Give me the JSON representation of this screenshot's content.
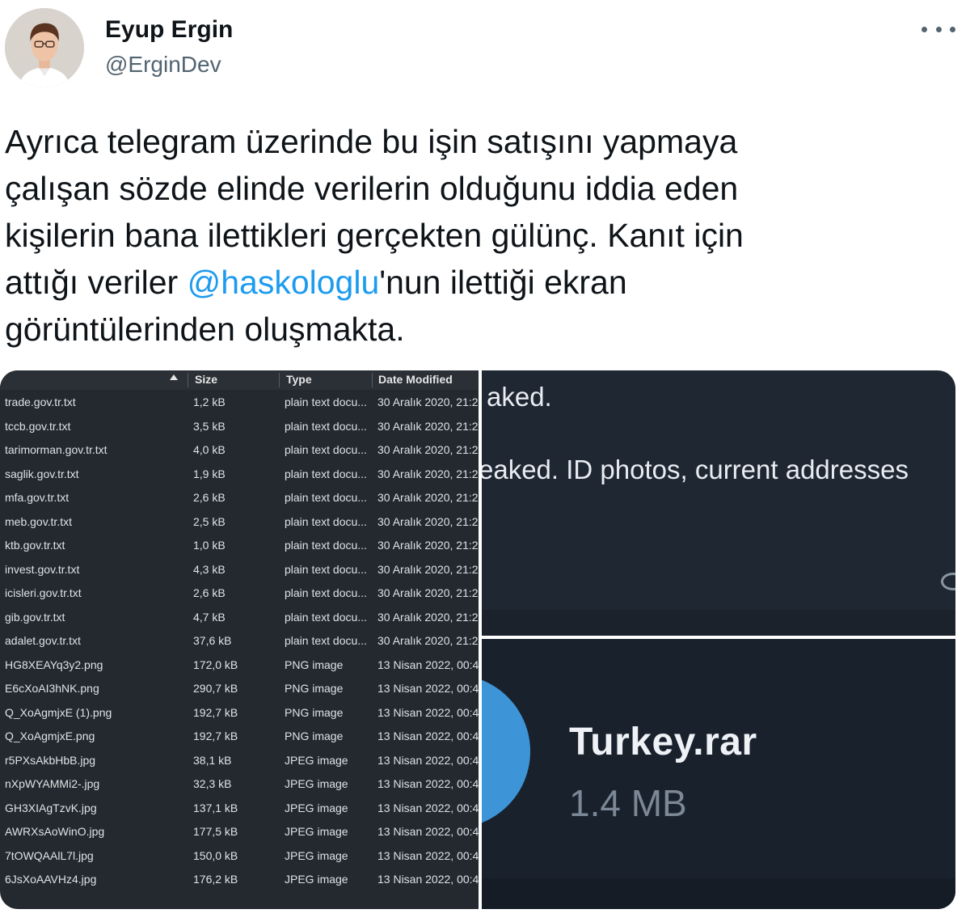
{
  "author": {
    "name": "Eyup Ergin",
    "handle": "@ErginDev"
  },
  "tweet": {
    "text_before": "Ayrıca telegram üzerinde bu işin satışını yapmaya\nçalışan sözde elinde verilerin olduğunu iddia eden\nkişilerin bana ilettikleri gerçekten gülünç. Kanıt için\nattığı veriler ",
    "mention": "@haskologlu",
    "text_after": "'nun ilettiği ekran\ngörüntülerinden oluşmakta."
  },
  "file_list": {
    "headers": {
      "size": "Size",
      "type": "Type",
      "date": "Date Modified"
    },
    "rows": [
      {
        "name": "trade.gov.tr.txt",
        "size": "1,2 kB",
        "type": "plain text docu...",
        "date": "30 Aralık 2020, 21:2"
      },
      {
        "name": "tccb.gov.tr.txt",
        "size": "3,5 kB",
        "type": "plain text docu...",
        "date": "30 Aralık 2020, 21:2"
      },
      {
        "name": "tarimorman.gov.tr.txt",
        "size": "4,0 kB",
        "type": "plain text docu...",
        "date": "30 Aralık 2020, 21:2"
      },
      {
        "name": "saglik.gov.tr.txt",
        "size": "1,9 kB",
        "type": "plain text docu...",
        "date": "30 Aralık 2020, 21:2"
      },
      {
        "name": "mfa.gov.tr.txt",
        "size": "2,6 kB",
        "type": "plain text docu...",
        "date": "30 Aralık 2020, 21:2"
      },
      {
        "name": "meb.gov.tr.txt",
        "size": "2,5 kB",
        "type": "plain text docu...",
        "date": "30 Aralık 2020, 21:2"
      },
      {
        "name": "ktb.gov.tr.txt",
        "size": "1,0 kB",
        "type": "plain text docu...",
        "date": "30 Aralık 2020, 21:2"
      },
      {
        "name": "invest.gov.tr.txt",
        "size": "4,3 kB",
        "type": "plain text docu...",
        "date": "30 Aralık 2020, 21:2"
      },
      {
        "name": "icisleri.gov.tr.txt",
        "size": "2,6 kB",
        "type": "plain text docu...",
        "date": "30 Aralık 2020, 21:2"
      },
      {
        "name": "gib.gov.tr.txt",
        "size": "4,7 kB",
        "type": "plain text docu...",
        "date": "30 Aralık 2020, 21:2"
      },
      {
        "name": "adalet.gov.tr.txt",
        "size": "37,6 kB",
        "type": "plain text docu...",
        "date": "30 Aralık 2020, 21:2"
      },
      {
        "name": "HG8XEAYq3y2.png",
        "size": "172,0 kB",
        "type": "PNG image",
        "date": "13 Nisan 2022, 00:4"
      },
      {
        "name": "E6cXoAI3hNK.png",
        "size": "290,7 kB",
        "type": "PNG image",
        "date": "13 Nisan 2022, 00:4"
      },
      {
        "name": "Q_XoAgmjxE (1).png",
        "size": "192,7 kB",
        "type": "PNG image",
        "date": "13 Nisan 2022, 00:4"
      },
      {
        "name": "Q_XoAgmjxE.png",
        "size": "192,7 kB",
        "type": "PNG image",
        "date": "13 Nisan 2022, 00:4"
      },
      {
        "name": "r5PXsAkbHbB.jpg",
        "size": "38,1 kB",
        "type": "JPEG image",
        "date": "13 Nisan 2022, 00:4"
      },
      {
        "name": "nXpWYAMMi2-.jpg",
        "size": "32,3 kB",
        "type": "JPEG image",
        "date": "13 Nisan 2022, 00:4"
      },
      {
        "name": "GH3XIAgTzvK.jpg",
        "size": "137,1 kB",
        "type": "JPEG image",
        "date": "13 Nisan 2022, 00:4"
      },
      {
        "name": "AWRXsAoWinO.jpg",
        "size": "177,5 kB",
        "type": "JPEG image",
        "date": "13 Nisan 2022, 00:4"
      },
      {
        "name": "7tOWQAAlL7l.jpg",
        "size": "150,0 kB",
        "type": "JPEG image",
        "date": "13 Nisan 2022, 00:4"
      },
      {
        "name": "6JsXoAAVHz4.jpg",
        "size": "176,2 kB",
        "type": "JPEG image",
        "date": "13 Nisan 2022, 00:4"
      }
    ]
  },
  "telegram_text": {
    "line1": "aked.",
    "line2": "eaked.  ID photos, current addresses"
  },
  "attachment": {
    "filename": "Turkey.rar",
    "filesize": "1.4 MB"
  },
  "colors": {
    "mention": "#1d9bf0",
    "file_manager_bg": "#24292f",
    "telegram_bg": "#1f2733",
    "file_icon": "#3d95d8"
  },
  "icons": {
    "more": "more-horizontal-icon",
    "sort": "sort-ascending-icon",
    "eye": "eye-icon",
    "file": "telegram-file-icon"
  }
}
